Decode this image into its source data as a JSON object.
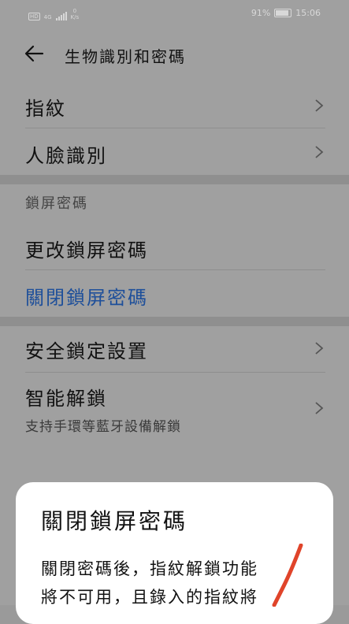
{
  "status_bar": {
    "hd": "HD",
    "network": "4G",
    "speed_value": "0",
    "speed_unit": "K/s",
    "battery": "91%",
    "time": "15:06"
  },
  "header": {
    "title": "生物識別和密碼"
  },
  "biometrics": {
    "items": [
      {
        "label": "指紋"
      },
      {
        "label": "人臉識別"
      }
    ]
  },
  "lock_screen": {
    "section_label": "鎖屏密碼",
    "change_label": "更改鎖屏密碼",
    "disable_label": "關閉鎖屏密碼"
  },
  "security": {
    "secure_lock_label": "安全鎖定設置",
    "smart_unlock_label": "智能解鎖",
    "smart_unlock_desc": "支持手環等藍牙設備解鎖"
  },
  "dialog": {
    "title": "關閉鎖屏密碼",
    "body_line1": "關閉密碼後，指紋解鎖功能",
    "body_line2": "將不可用，且錄入的指紋將"
  },
  "colors": {
    "accent": "#1e4f9a",
    "annotation": "#e0442a"
  }
}
